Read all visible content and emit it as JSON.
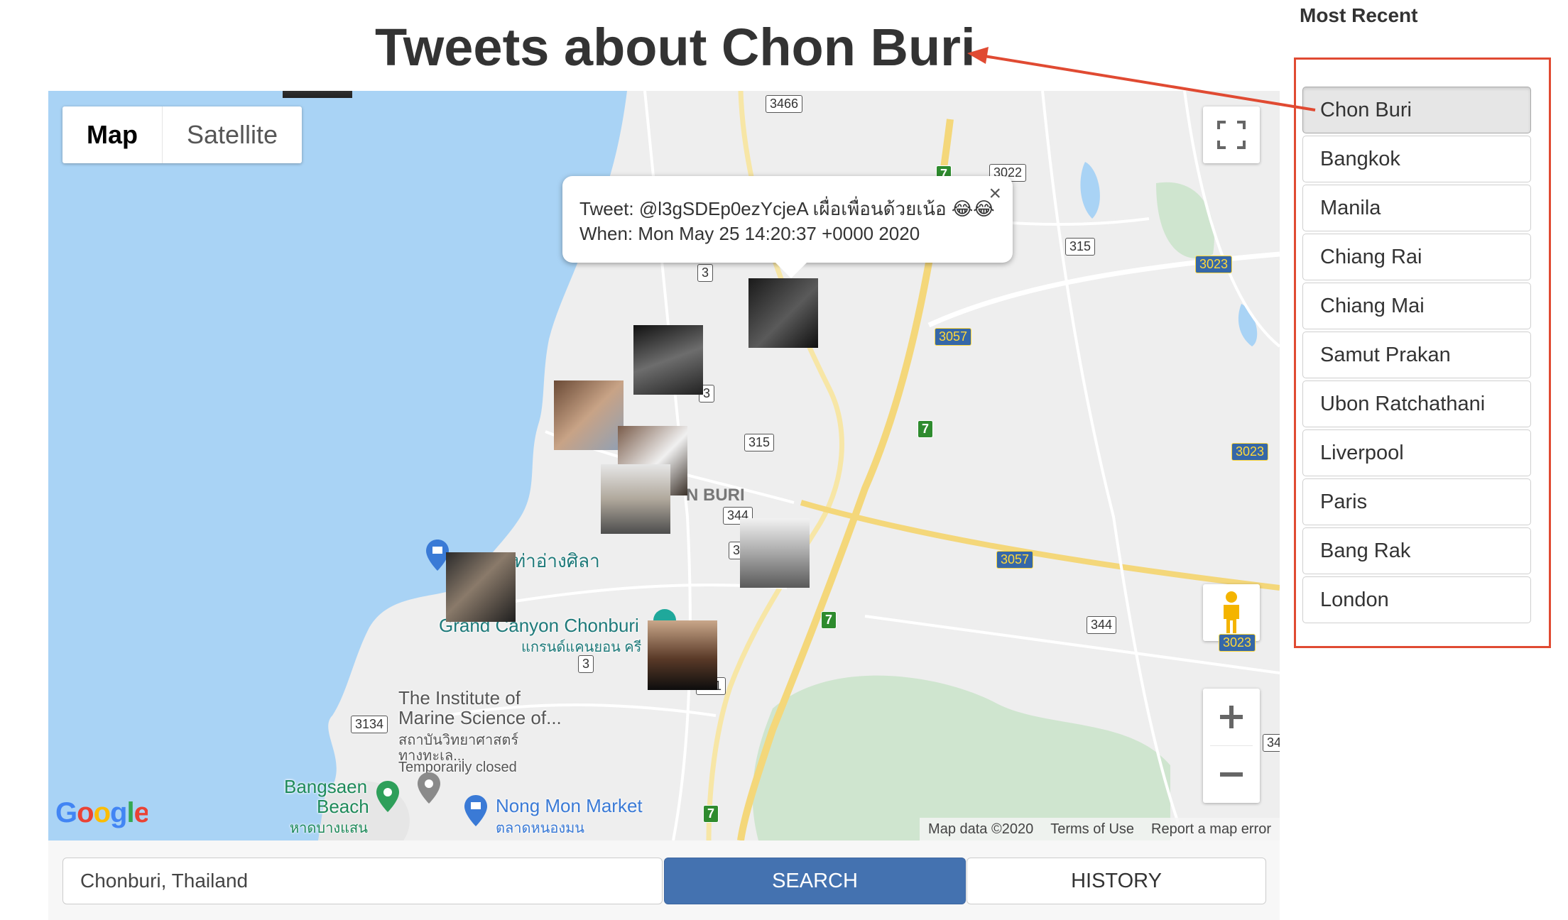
{
  "page": {
    "title": "Tweets about Chon Buri",
    "recent_heading": "Most Recent"
  },
  "map": {
    "type_control": {
      "map_label": "Map",
      "satellite_label": "Satellite",
      "selected": "Map"
    },
    "info_window": {
      "tweet_line": "Tweet: @l3gSDEp0ezYcjeA เผื่อเพื่อนด้วยเน้อ 😂😂",
      "when_line": "When: Mon May 25 14:20:37 +0000 2020",
      "close_glyph": "×"
    },
    "labels": {
      "area": "N BURI",
      "poi_1": "ท่าอ่างศิลา",
      "poi_2": "Grand Canyon Chonburi",
      "poi_2_thai": "แกรนด์แคนยอน ครี",
      "poi_3_line1": "The Institute of",
      "poi_3_line2": "Marine Science of...",
      "poi_3_thai1": "สถาบันวิทยาศาสตร์",
      "poi_3_thai2": "ทางทะเล...",
      "poi_3_status": "Temporarily closed",
      "poi_4_line1": "Bangsaen",
      "poi_4_line2": "Beach",
      "poi_4_thai": "หาดบางแสน",
      "poi_5": "Nong Mon Market",
      "poi_5_thai": "ตลาดหนองมน"
    },
    "road_shields": {
      "r3466": "3466",
      "r3022": "3022",
      "r315a": "315",
      "r3023a": "3023",
      "r3a": "3",
      "r3b": "3",
      "r3c": "3",
      "r3057a": "3057",
      "r315b": "315",
      "r3023b": "3023",
      "r344a": "344",
      "r3d": "3",
      "r3057b": "3057",
      "r344b": "344",
      "r3023c": "3023",
      "r3134": "3134",
      "r361": "361",
      "r34": "34",
      "r7a": "7",
      "r7b": "7",
      "r7c": "7",
      "r7d": "7"
    },
    "footer": {
      "map_data": "Map data ©2020",
      "terms": "Terms of Use",
      "report": "Report a map error"
    },
    "google_logo": "Google",
    "icons": [
      "fullscreen-icon",
      "pegman-icon",
      "zoom-in-icon",
      "zoom-out-icon",
      "close-icon"
    ]
  },
  "search": {
    "input_value": "Chonburi, Thailand",
    "search_label": "SEARCH",
    "history_label": "HISTORY"
  },
  "recent": {
    "items": [
      {
        "label": "Chon Buri",
        "active": true
      },
      {
        "label": "Bangkok",
        "active": false
      },
      {
        "label": "Manila",
        "active": false
      },
      {
        "label": "Chiang Rai",
        "active": false
      },
      {
        "label": "Chiang Mai",
        "active": false
      },
      {
        "label": "Samut Prakan",
        "active": false
      },
      {
        "label": "Ubon Ratchathani",
        "active": false
      },
      {
        "label": "Liverpool",
        "active": false
      },
      {
        "label": "Paris",
        "active": false
      },
      {
        "label": "Bang Rak",
        "active": false
      },
      {
        "label": "London",
        "active": false
      }
    ]
  },
  "colors": {
    "annotation": "#e04a32",
    "search_button": "#4472b0",
    "water": "#a9d3f5",
    "land": "#eeeeee"
  }
}
